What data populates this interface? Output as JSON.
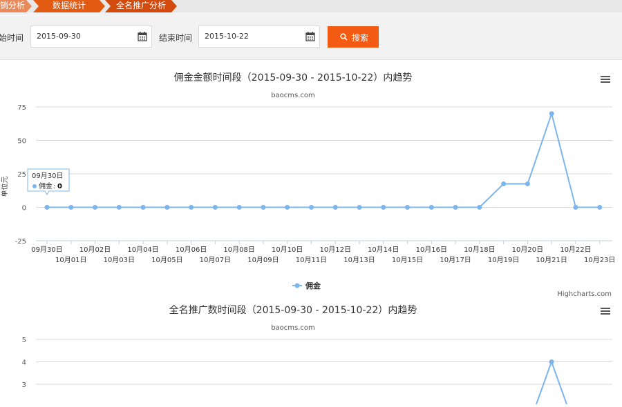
{
  "breadcrumbs": [
    "销分析",
    "数据统计",
    "全名推广分析"
  ],
  "filters": {
    "start_label": "始时间",
    "start_value": "2015-09-30",
    "end_label": "结束时间",
    "end_value": "2015-10-22",
    "search_label": "搜索"
  },
  "colors": {
    "accent": "#f35a12",
    "series": "#7cb5ec"
  },
  "chart_data": [
    {
      "type": "line",
      "title": "佣金金额时间段（2015-09-30 - 2015-10-22）内趋势",
      "subtitle": "baocms.com",
      "ylabel": "单位元",
      "ylim": [
        -25,
        75
      ],
      "yticks": [
        -25,
        0,
        25,
        50,
        75
      ],
      "categories": [
        "09月30日",
        "10月01日",
        "10月02日",
        "10月03日",
        "10月04日",
        "10月05日",
        "10月06日",
        "10月07日",
        "10月08日",
        "10月09日",
        "10月10日",
        "10月11日",
        "10月12日",
        "10月13日",
        "10月14日",
        "10月15日",
        "10月16日",
        "10月17日",
        "10月18日",
        "10月19日",
        "10月20日",
        "10月21日",
        "10月22日",
        "10月23日"
      ],
      "series": [
        {
          "name": "佣金",
          "values": [
            0,
            0,
            0,
            0,
            0,
            0,
            0,
            0,
            0,
            0,
            0,
            0,
            0,
            0,
            0,
            0,
            0,
            0,
            0,
            17.5,
            17.5,
            70,
            0,
            0
          ]
        }
      ],
      "grid": true,
      "legend": "bottom-center",
      "credits": "Highcharts.com",
      "tooltip": {
        "date": "09月30日",
        "series": "佣金",
        "value": "0"
      }
    },
    {
      "type": "line",
      "title": "全名推广数时间段（2015-09-30 - 2015-10-22）内趋势",
      "subtitle": "baocms.com",
      "ylim": [
        3,
        5
      ],
      "yticks": [
        3,
        4,
        5
      ],
      "peak": {
        "category": "10月21日",
        "value": 4
      }
    }
  ]
}
